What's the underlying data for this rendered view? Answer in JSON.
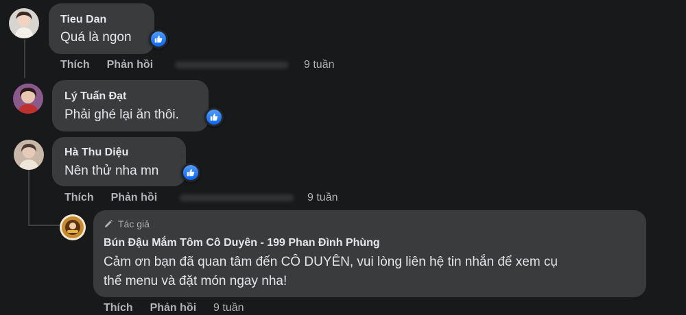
{
  "comments": [
    {
      "name": "Tieu Dan",
      "text": "Quá là ngon",
      "like_label": "Thích",
      "reply_label": "Phản hồi",
      "time": "9 tuần"
    },
    {
      "name": "Lý Tuấn Đạt",
      "text": "Phải ghé lại ăn thôi."
    },
    {
      "name": "Hà Thu Diệu",
      "text": "Nên thử nha mn",
      "like_label": "Thích",
      "reply_label": "Phản hồi",
      "time": "9 tuần"
    }
  ],
  "reply": {
    "author_tag": "Tác giả",
    "name": "Bún Đậu Mắm Tôm Cô Duyên - 199 Phan Đình Phùng",
    "text_line1": "Cảm ơn bạn đã quan tâm đến CÔ DUYÊN, vui lòng liên hệ tin nhắn để xem cụ",
    "text_line2": "thể menu và đặt món ngay nha!",
    "like_label": "Thích",
    "reply_label": "Phản hồi",
    "time": "9 tuần"
  },
  "icons": {
    "reaction": "like-thumbs-up-icon",
    "author": "pencil-icon"
  },
  "colors": {
    "background": "#18191a",
    "bubble": "#3a3b3c",
    "text": "#e4e6eb",
    "muted": "#b0b3b8",
    "like_blue": "#0866ff"
  }
}
